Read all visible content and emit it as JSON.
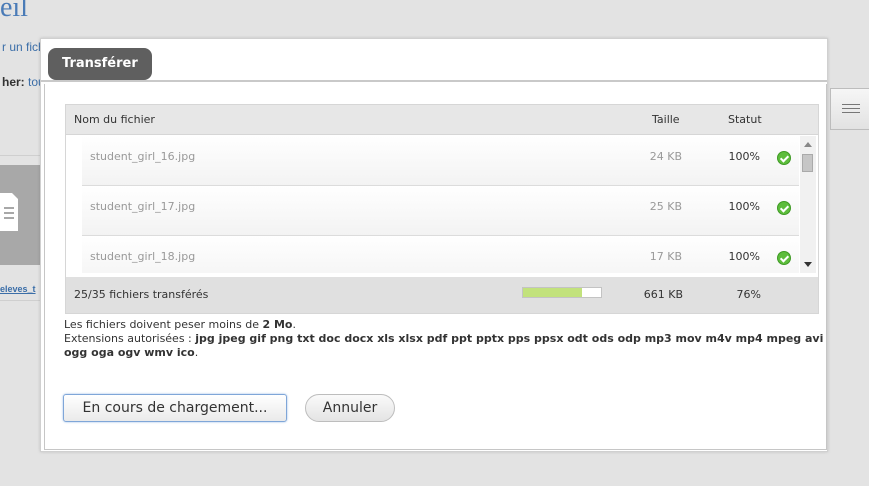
{
  "background": {
    "title_fragment": "eil",
    "link_fragment": "r un fich",
    "label_bold": "her:",
    "label_link": "tou",
    "file_link": "eleves_t"
  },
  "dialog": {
    "tab_label": "Transférer",
    "table": {
      "headers": {
        "name": "Nom du fichier",
        "size": "Taille",
        "status": "Statut"
      },
      "rows": [
        {
          "name": "student_girl_16.jpg",
          "size": "24 KB",
          "status": "100%",
          "icon": "check-icon"
        },
        {
          "name": "student_girl_17.jpg",
          "size": "25 KB",
          "status": "100%",
          "icon": "check-icon"
        },
        {
          "name": "student_girl_18.jpg",
          "size": "17 KB",
          "status": "100%",
          "icon": "check-icon"
        }
      ],
      "footer": {
        "count": "25/35 fichiers transférés",
        "total_size": "661 KB",
        "percent": "76%",
        "progress_fraction": 0.76
      }
    },
    "info": {
      "size_prefix": "Les fichiers doivent peser moins de",
      "size_limit": "2 Mo",
      "size_suffix": ".",
      "ext_prefix": "Extensions autorisées :",
      "extensions": "jpg jpeg gif png txt doc docx xls xlsx pdf ppt pptx pps ppsx odt ods odp mp3 mov m4v mp4 mpeg avi ogg oga ogv wmv ico",
      "ext_suffix": "."
    },
    "buttons": {
      "loading": "En cours de chargement...",
      "cancel": "Annuler"
    }
  },
  "colors": {
    "tab_bg": "#5f5f5f",
    "progress_fill": "#c2e27c",
    "check": "#5dbd3c",
    "link": "#3b6ea8"
  }
}
